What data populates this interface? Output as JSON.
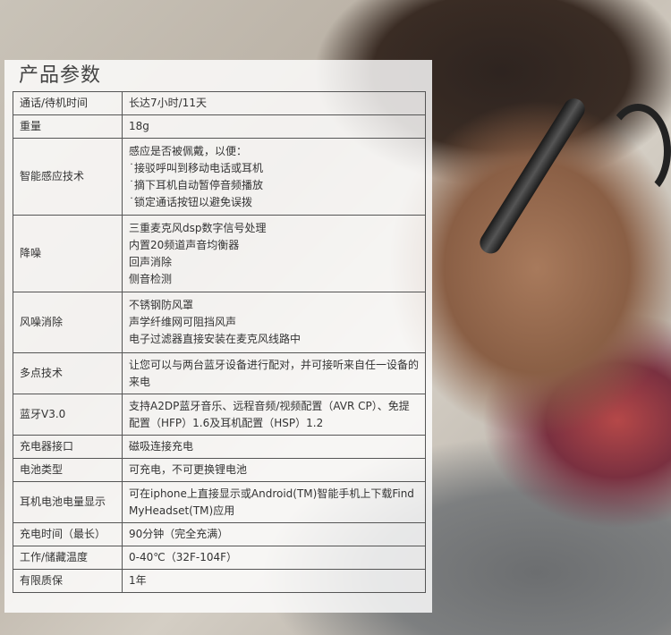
{
  "section": {
    "title": "产品参数"
  },
  "specs": [
    {
      "label": "通话/待机时间",
      "lines": [
        "长达7小时/11天"
      ]
    },
    {
      "label": "重量",
      "lines": [
        "18g"
      ]
    },
    {
      "label": "智能感应技术",
      "lines": [
        "感应是否被佩戴，以便：",
        "˙接驳呼叫到移动电话或耳机",
        "˙摘下耳机自动暂停音频播放",
        "˙锁定通话按钮以避免误拨"
      ]
    },
    {
      "label": "降噪",
      "lines": [
        "三重麦克风dsp数字信号处理",
        "内置20频道声音均衡器",
        "回声消除",
        "侧音检测"
      ]
    },
    {
      "label": "风噪消除",
      "lines": [
        "不锈钢防风罩",
        "声学纤维网可阻挡风声",
        "电子过滤器直接安装在麦克风线路中"
      ]
    },
    {
      "label": "多点技术",
      "lines": [
        "让您可以与两台蓝牙设备进行配对，并可接听来自任一设备的来电"
      ]
    },
    {
      "label": "蓝牙V3.0",
      "lines": [
        "支持A2DP蓝牙音乐、远程音频/视频配置（AVR CP）、免提配置（HFP）1.6及耳机配置（HSP）1.2"
      ]
    },
    {
      "label": "充电器接口",
      "lines": [
        "磁吸连接充电"
      ]
    },
    {
      "label": "电池类型",
      "lines": [
        "可充电，不可更换锂电池"
      ]
    },
    {
      "label": "耳机电池电量显示",
      "lines": [
        "可在iphone上直接显示或Android(TM)智能手机上下载Find MyHeadset(TM)应用"
      ]
    },
    {
      "label": "充电时间（最长）",
      "lines": [
        "90分钟（完全充满）"
      ]
    },
    {
      "label": "工作/储藏温度",
      "lines": [
        "0-40℃（32F-104F）"
      ]
    },
    {
      "label": "有限质保",
      "lines": [
        "1年"
      ]
    }
  ]
}
